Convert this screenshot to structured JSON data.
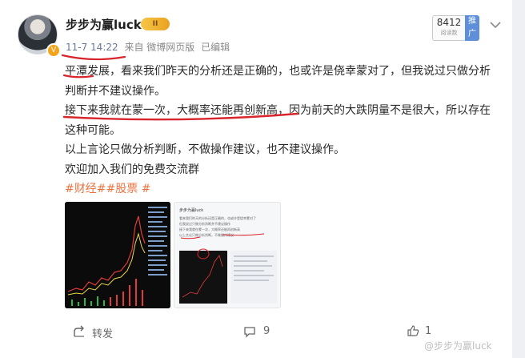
{
  "post": {
    "username": "步步为赢luck",
    "vip_badge": "II",
    "time": "11-7 14:22",
    "source": "来自 微博网页版",
    "edited": "已编辑",
    "hot_count": "8412",
    "hot_label": "阅读数",
    "promote": "推广",
    "more_icon": "chevron-down-icon",
    "paragraphs": [
      "平潭发展，看来我们昨天的分析还是正确的，也或许是侥幸蒙对了，但我说过只做分析判断并不建议操作。",
      "接下来我就在蒙一次，大概率还能再创新高，因为前天的大跌阴量不是很大，所以存在这种可能。",
      "以上言论只做分析判断，不做操作建议，也不建议操作。",
      "欢迎加入我们的免费交流群"
    ],
    "topics": "#财经##股票 #",
    "image2_caption": "步步为赢luck",
    "image2_lines": [
      "看来我们昨天的分析还是正确的，也或许是侥幸蒙对了",
      "但我说过只做分析判断并不建议操作",
      "接下来我就在蒙一次，大概率还能再创新高",
      "以上言论只做分析判断，不做操作建议"
    ]
  },
  "footer": {
    "repost_label": "转发",
    "comment_count": "9",
    "like_count": "1"
  },
  "watermark": "@步步为赢luck",
  "colors": {
    "topic": "#eb7340",
    "annotation": "#d8262c",
    "link": "#6b7a99"
  }
}
